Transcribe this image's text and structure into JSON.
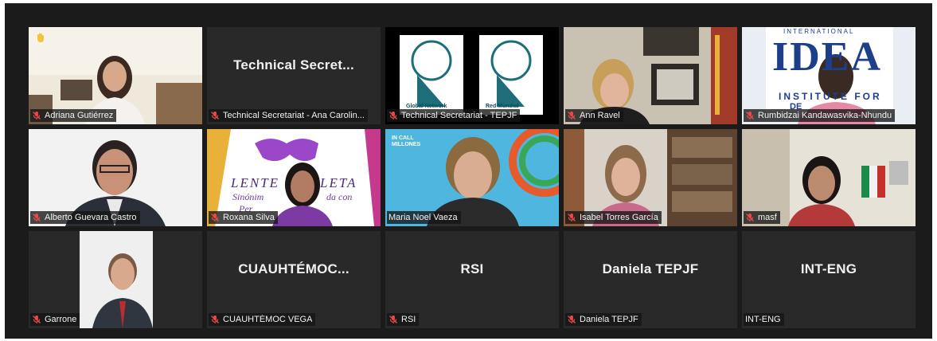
{
  "accent": {
    "active_speaker_border": "#e9d85b",
    "mute_icon": "#e5484d",
    "raised_hand": "#f3c33a"
  },
  "icons": {
    "mute": "microphone-muted-icon",
    "raise_hand": "raised-hand-icon"
  },
  "tiles": [
    {
      "name": "Adriana Gutiérrez",
      "muted": true,
      "hand_raised": true
    },
    {
      "name": "Technical Secretariat - Ana Carolin...",
      "display": "Technical  Secret...",
      "muted": true
    },
    {
      "name": "Technical Secretariat - TEPJF",
      "muted": true,
      "logo_text_1": "Global Network",
      "logo_text_2": "Red Mundial"
    },
    {
      "name": "Ann Ravel",
      "muted": true
    },
    {
      "name": "Rumbidzai Kandawasvika-Nhundu",
      "muted": true,
      "banner_top": "INTERNATIONAL",
      "banner_logo": "IDEA",
      "banner_bottom": "INSTITUTE FOR",
      "banner_bottom2": "DE"
    },
    {
      "name": "Alberto Guevara Castro",
      "muted": true
    },
    {
      "name": "Roxana Silva",
      "muted": true,
      "banner_1": "LENTE",
      "banner_2": "LETA",
      "banner_3": "Sinónim",
      "banner_4": "da con",
      "banner_5": "Per"
    },
    {
      "name": "Maria Noel Vaeza",
      "muted": false,
      "active": true,
      "logo_text_1": "IN CALL",
      "logo_text_2": "MILLONES"
    },
    {
      "name": "Isabel Torres García",
      "muted": true
    },
    {
      "name": "masf",
      "muted": true
    },
    {
      "name": "Garrone",
      "muted": true
    },
    {
      "name": "CUAUHTÉMOC VEGA",
      "display": "CUAUHTÉMOC...",
      "muted": true
    },
    {
      "name": "RSI",
      "display": "RSI",
      "muted": true
    },
    {
      "name": "Daniela TEPJF",
      "display": "Daniela TEPJF",
      "muted": true
    },
    {
      "name": "INT-ENG",
      "display": "INT-ENG",
      "muted": false
    }
  ]
}
